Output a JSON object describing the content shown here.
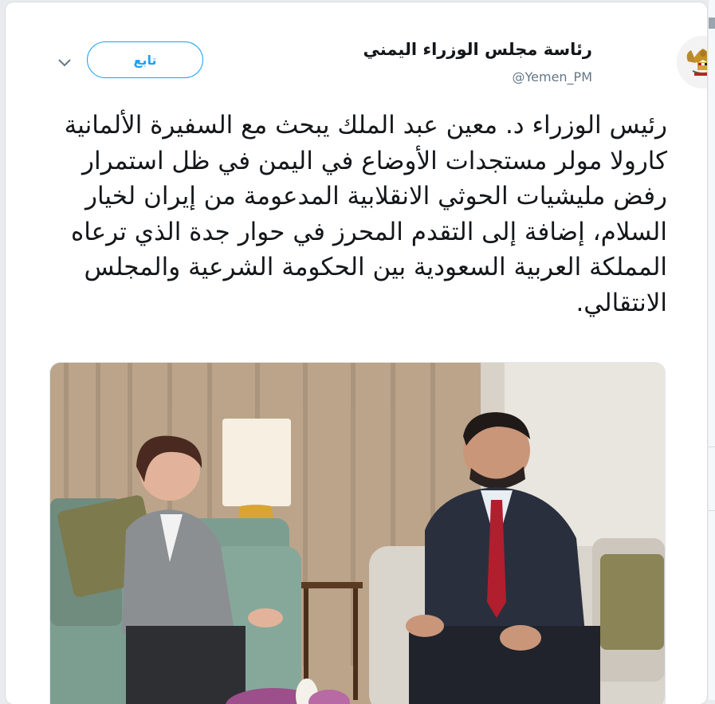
{
  "tweet": {
    "display_name": "رئاسة مجلس الوزراء اليمني",
    "handle": "@Yemen_PM",
    "follow_label": "تابع",
    "text": "رئيس الوزراء د. معين عبد الملك يبحث مع السفيرة الألمانية كارولا مولر مستجدات الأوضاع في اليمن في ظل استمرار رفض مليشيات الحوثي الانقلابية المدعومة من إيران لخيار السلام، إضافة إلى التقدم المحرز في حوار جدة الذي ترعاه المملكة العربية السعودية بين الحكومة الشرعية والمجلس الانتقالي.",
    "avatar_icon": "yemen-emblem-icon",
    "more_icon": "chevron-down-icon",
    "accent_color": "#1da1f2"
  },
  "media": {
    "type": "photo",
    "icon": "meeting-photo"
  }
}
